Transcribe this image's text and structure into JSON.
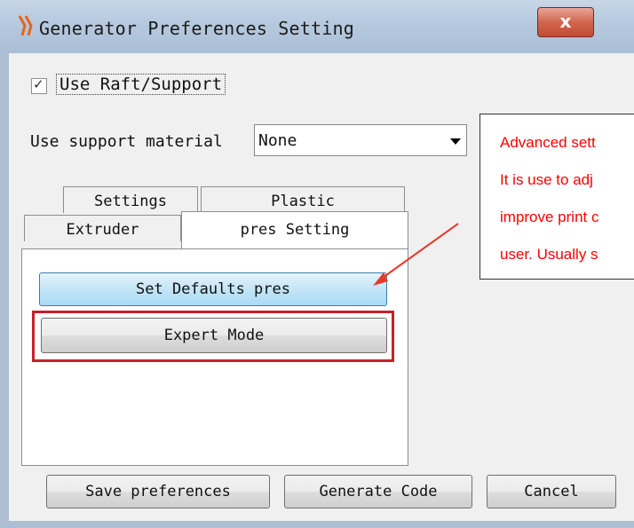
{
  "window": {
    "title": "Generator Preferences Setting",
    "close_label": "x"
  },
  "raft": {
    "checked": true,
    "check_mark": "✓",
    "label": "Use Raft/Support"
  },
  "support": {
    "label": "Use support material",
    "selected": "None"
  },
  "tabs": [
    {
      "label": "Settings"
    },
    {
      "label": "Plastic"
    },
    {
      "label": "Extruder"
    },
    {
      "label": "pres Setting",
      "active": true
    }
  ],
  "panel": {
    "set_defaults_label": "Set Defaults pres",
    "expert_mode_label": "Expert Mode"
  },
  "footer": {
    "save_label": "Save preferences",
    "generate_label": "Generate Code",
    "cancel_label": "Cancel"
  },
  "annotation": {
    "lines": [
      "Advanced sett",
      "It is use to adj",
      "improve print c",
      "user. Usually s"
    ],
    "color": "#ff0000",
    "highlight_color": "#c8202a"
  }
}
